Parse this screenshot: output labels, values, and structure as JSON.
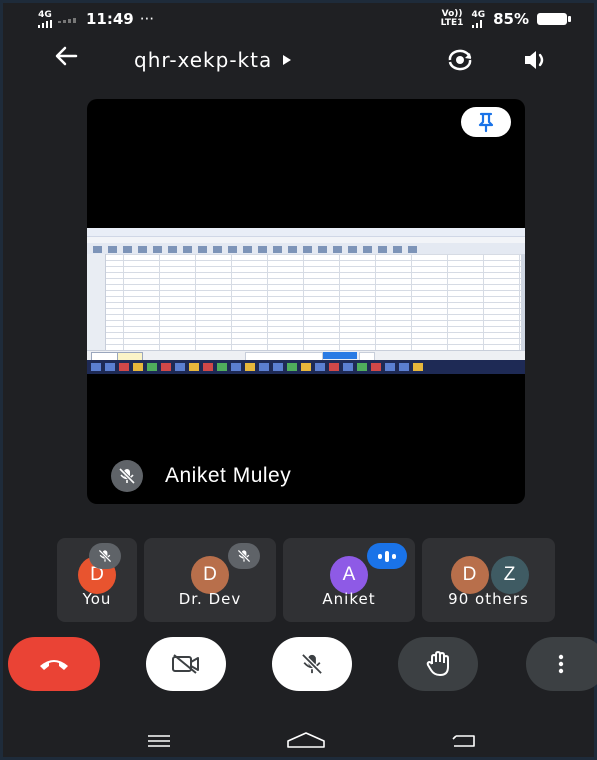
{
  "status_bar": {
    "network_left_tag": "4G",
    "time": "11:49",
    "overflow": "···",
    "volte_top": "Vo))",
    "volte_bottom": "LTE1",
    "network_right": "4G",
    "battery": "85%"
  },
  "header": {
    "meeting_code": "qhr-xekp-kta",
    "back_icon": "arrow-back-icon",
    "camera_switch_icon": "camera-switch-icon",
    "speaker_icon": "speaker-icon"
  },
  "main_tile": {
    "speaker_name": "Aniket Muley",
    "pin_icon": "pin-icon",
    "muted": true,
    "content": "shared-screen-spreadsheet"
  },
  "participants": [
    {
      "initial": "D",
      "label": "You",
      "color": "#e8542f",
      "muted": true
    },
    {
      "initial": "D",
      "label": "Dr. Dev",
      "color": "#b86f4b",
      "muted": true
    },
    {
      "initial": "A",
      "label": "Aniket",
      "color": "#8e5ae6",
      "speaking": true
    },
    {
      "initial_a": "D",
      "initial_b": "Z",
      "label": "90 others",
      "color_a": "#b86f4b",
      "color_b": "#3f5b63"
    }
  ],
  "controls": [
    "end-call",
    "camera-off",
    "mic-off",
    "raise-hand",
    "more-options"
  ],
  "colors": {
    "background": "#1f2023",
    "end_call": "#ea4335",
    "tile": "#303134",
    "accent": "#1a73e8"
  }
}
